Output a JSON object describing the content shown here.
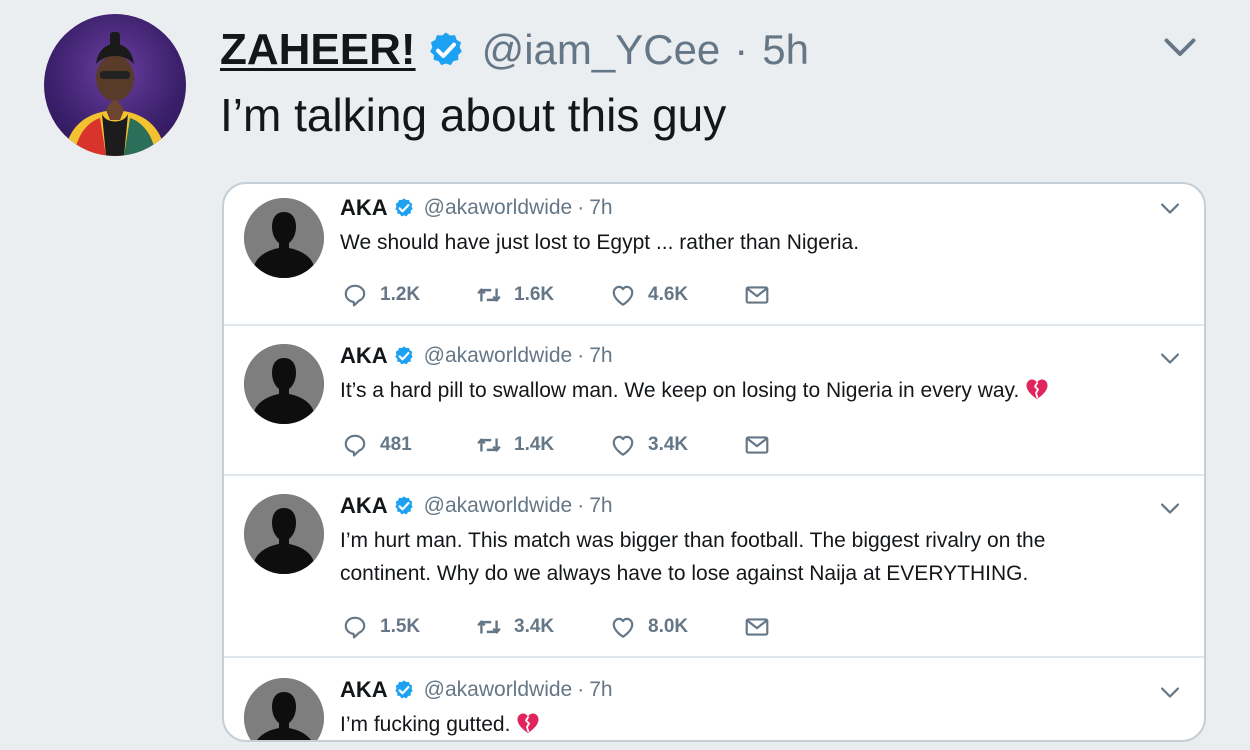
{
  "main_tweet": {
    "display_name": "ZAHEER!",
    "handle": "@iam_YCee",
    "separator": "·",
    "time": "5h",
    "text": "I’m talking about this guy"
  },
  "quoted_tweets": [
    {
      "name": "AKA",
      "handle": "@akaworldwide",
      "time": "7h",
      "text": "We should have just lost to Egypt ... rather than Nigeria.",
      "replies": "1.2K",
      "retweets": "1.6K",
      "likes": "4.6K"
    },
    {
      "name": "AKA",
      "handle": "@akaworldwide",
      "time": "7h",
      "text": "It’s a hard pill to swallow man. We keep on losing to Nigeria in every way.",
      "replies": "481",
      "retweets": "1.4K",
      "likes": "3.4K"
    },
    {
      "name": "AKA",
      "handle": "@akaworldwide",
      "time": "7h",
      "text": "I’m hurt man. This match was bigger than football. The biggest rivalry on the continent. Why do we always have to lose against Naija at EVERYTHING.",
      "replies": "1.5K",
      "retweets": "3.4K",
      "likes": "8.0K"
    },
    {
      "name": "AKA",
      "handle": "@akaworldwide",
      "time": "7h",
      "text": "I’m fucking gutted."
    }
  ],
  "icons": [
    "verified-badge-icon",
    "chevron-down-icon",
    "reply-icon",
    "retweet-icon",
    "like-icon",
    "message-icon",
    "broken-heart-icon"
  ],
  "colors": {
    "background": "#eaeef1",
    "verified_blue": "#1da1f2",
    "muted_text": "#657786",
    "broken_heart": "#e0245e"
  }
}
